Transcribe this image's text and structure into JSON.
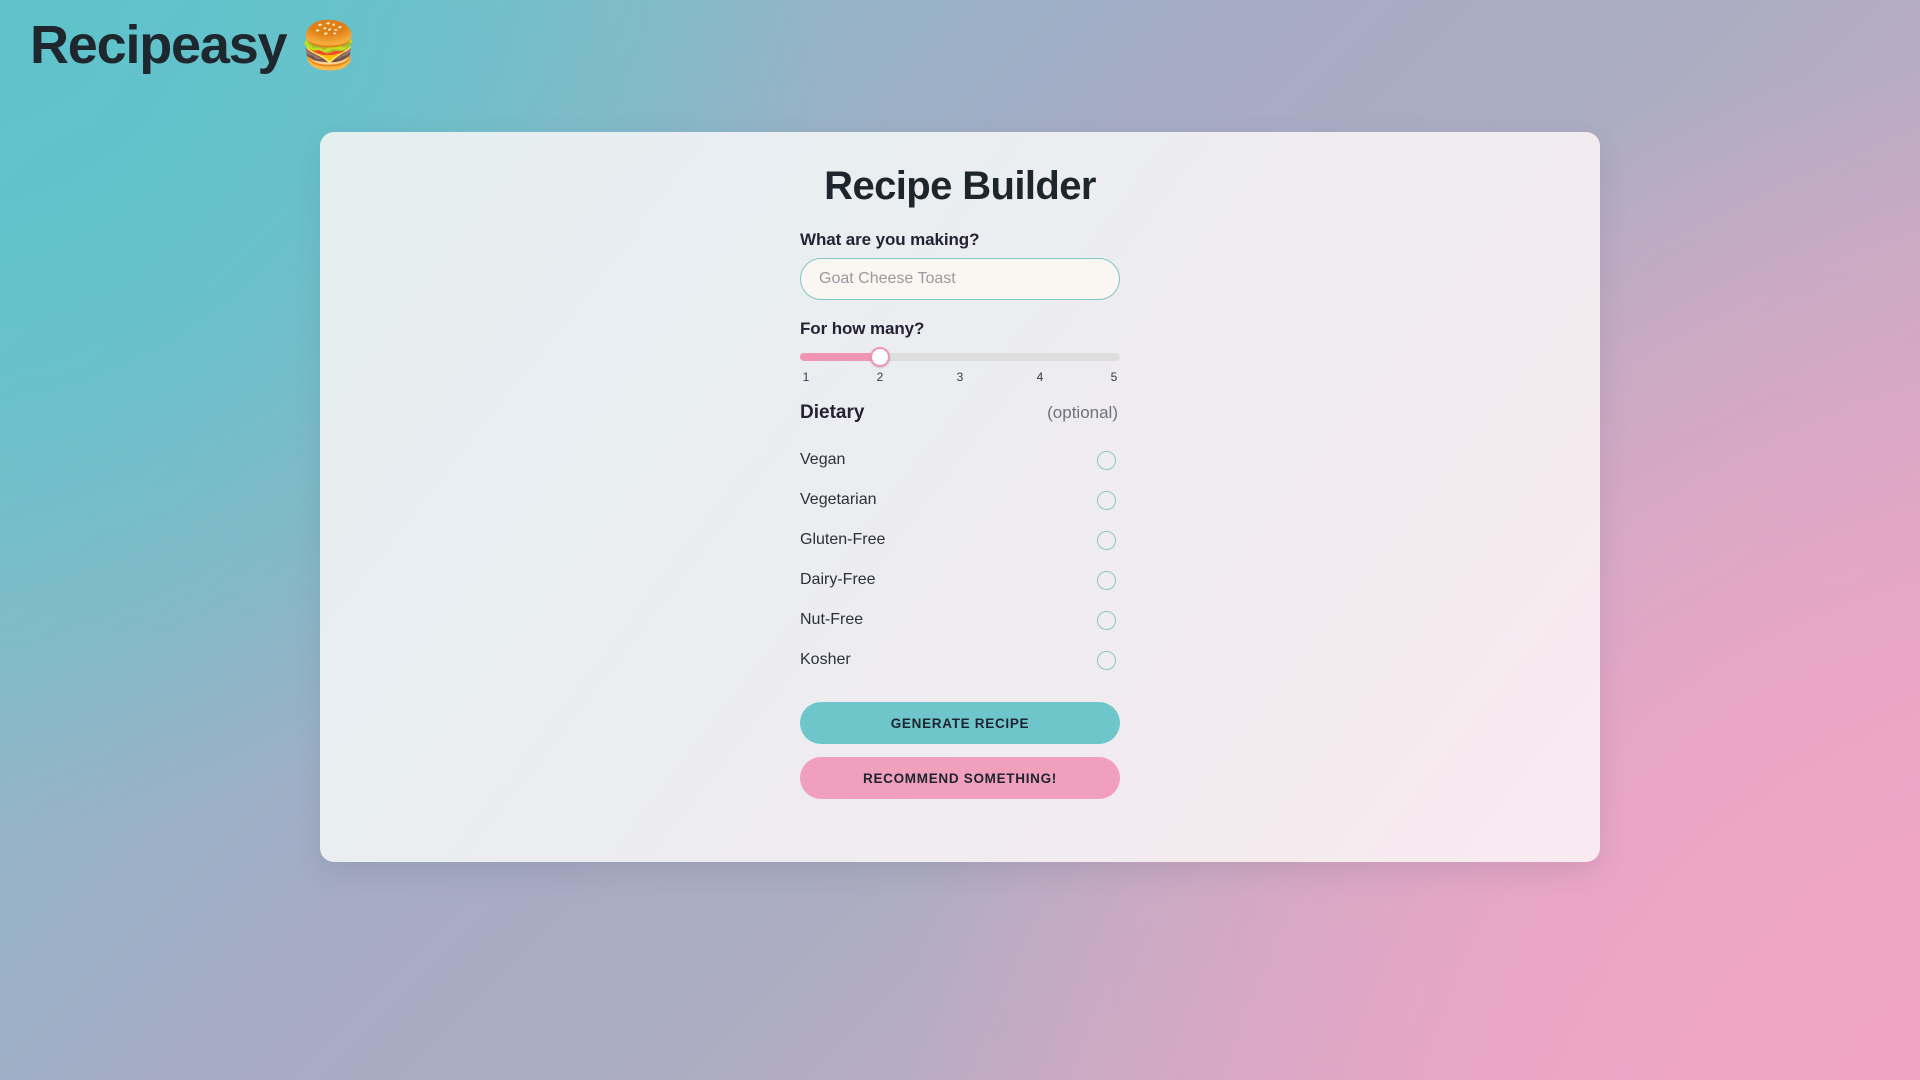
{
  "app": {
    "title": "Recipeasy",
    "emoji": "🍔",
    "emoji_name": "hamburger-emoji"
  },
  "card": {
    "title": "Recipe Builder"
  },
  "dish": {
    "label": "What are you making?",
    "value": "",
    "placeholder": "Goat Cheese Toast"
  },
  "servings": {
    "label": "For how many?",
    "value": 2,
    "min": 1,
    "max": 5,
    "ticks": [
      "1",
      "2",
      "3",
      "4",
      "5"
    ]
  },
  "dietary": {
    "title": "Dietary",
    "optional_note": "(optional)",
    "options": [
      {
        "label": "Vegan",
        "checked": false
      },
      {
        "label": "Vegetarian",
        "checked": false
      },
      {
        "label": "Gluten-Free",
        "checked": false
      },
      {
        "label": "Dairy-Free",
        "checked": false
      },
      {
        "label": "Nut-Free",
        "checked": false
      },
      {
        "label": "Kosher",
        "checked": false
      }
    ]
  },
  "buttons": {
    "generate": "GENERATE RECIPE",
    "recommend": "RECOMMEND SOMETHING!"
  },
  "colors": {
    "background_start": "#76c3cb",
    "background_mid": "#a8aec6",
    "background_end": "#e8a7c6",
    "card_start": "#e5eff0",
    "card_end": "#f8eaf0",
    "accent_teal": "#6ec6cb",
    "accent_pink": "#f0a0bd",
    "slider_fill": "#f095b4",
    "slider_track": "#dedede",
    "input_border": "#7fc9c0",
    "input_background": "#faf6f2",
    "checkbox_border": "#8cc7c2",
    "text_dark": "#1f272e"
  }
}
